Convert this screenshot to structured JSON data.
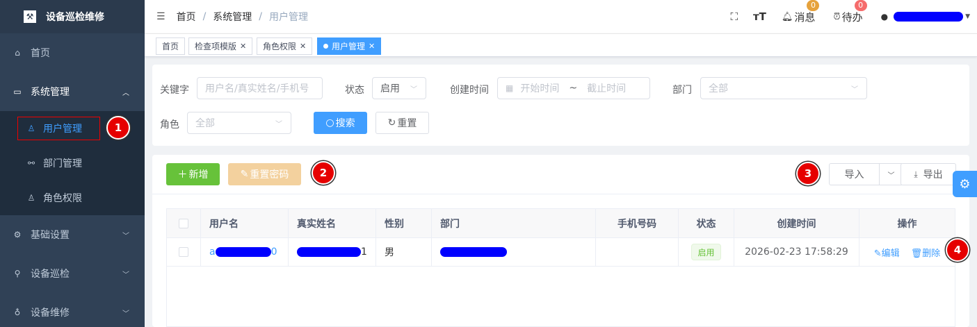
{
  "app": {
    "title": "设备巡检维修"
  },
  "sidebar": {
    "items": [
      {
        "label": "首页",
        "icon": "home-icon"
      },
      {
        "label": "系统管理",
        "icon": "monitor-icon"
      },
      {
        "label": "基础设置",
        "icon": "gear-icon"
      },
      {
        "label": "设备巡检",
        "icon": "search-icon"
      },
      {
        "label": "设备维修",
        "icon": "bulb-icon"
      }
    ],
    "submenu": [
      {
        "label": "用户管理",
        "icon": "user-icon"
      },
      {
        "label": "部门管理",
        "icon": "tree-icon"
      },
      {
        "label": "角色权限",
        "icon": "people-icon"
      }
    ]
  },
  "header": {
    "breadcrumb": [
      "首页",
      "系统管理",
      "用户管理"
    ],
    "messages_label": "消息",
    "messages_count": "0",
    "todo_label": "待办",
    "todo_count": "0"
  },
  "tags": [
    {
      "label": "首页"
    },
    {
      "label": "检查项模版"
    },
    {
      "label": "角色权限"
    },
    {
      "label": "用户管理"
    }
  ],
  "search": {
    "keyword_label": "关键字",
    "keyword_placeholder": "用户名/真实姓名/手机号",
    "status_label": "状态",
    "status_value": "启用",
    "created_label": "创建时间",
    "start_placeholder": "开始时间",
    "range_sep": "~",
    "end_placeholder": "截止时间",
    "dept_label": "部门",
    "dept_value": "全部",
    "role_label": "角色",
    "role_value": "全部",
    "search_button": "搜索",
    "reset_button": "重置"
  },
  "toolbar": {
    "add_button": "新增",
    "reset_password_button": "重置密码",
    "import_button": "导入",
    "export_button": "导出"
  },
  "table": {
    "columns": [
      "用户名",
      "真实姓名",
      "性别",
      "部门",
      "手机号码",
      "状态",
      "创建时间",
      "操作"
    ],
    "rows": [
      {
        "username_prefix": "a",
        "username_suffix": "0",
        "realname_suffix": "1",
        "gender": "男",
        "phone": "",
        "status": "启用",
        "created": "2026-02-23 17:58:29",
        "edit": "编辑",
        "delete": "删除"
      }
    ]
  },
  "markers": [
    "1",
    "2",
    "3",
    "4"
  ],
  "colors": {
    "primary": "#409eff",
    "success": "#67c23a",
    "sidebar": "#304156",
    "marker": "#e60000",
    "redaction": "#0000ff"
  }
}
